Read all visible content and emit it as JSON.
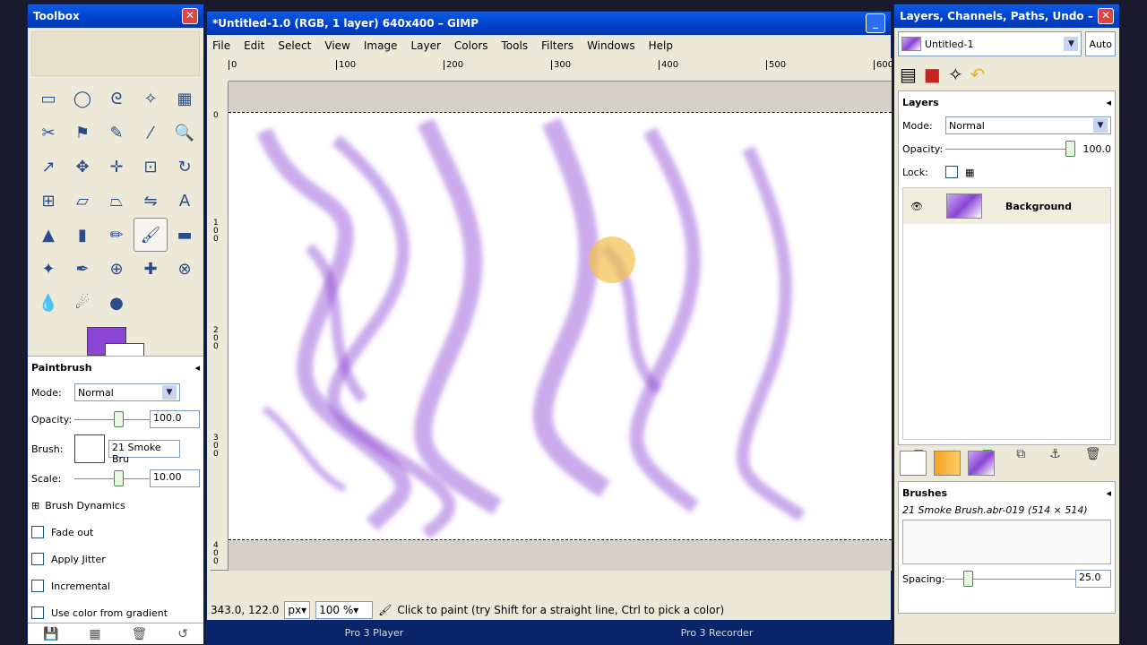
{
  "toolbox": {
    "title": "Toolbox",
    "close": "✕",
    "tool_icons": [
      "rect-select-icon",
      "ellipse-select-icon",
      "lasso-icon",
      "fuzzy-select-icon",
      "color-select-icon",
      "scissors-icon",
      "foreground-select-icon",
      "paths-icon",
      "color-picker-icon",
      "zoom-icon",
      "measure-icon",
      "move-icon",
      "align-icon",
      "crop-icon",
      "rotate-icon",
      "scale-icon",
      "shear-icon",
      "perspective-icon",
      "flip-icon",
      "text-icon",
      "bucket-fill-icon",
      "blend-icon",
      "pencil-icon",
      "paintbrush-icon",
      "eraser-icon",
      "airbrush-icon",
      "ink-icon",
      "clone-icon",
      "heal-icon",
      "perspective-clone-icon",
      "blur-icon",
      "smudge-icon",
      "dodge-icon"
    ],
    "tool_glyphs": [
      "▭",
      "◯",
      "ᘓ",
      "✧",
      "▦",
      "✂",
      "⚑",
      "✎",
      "⁄",
      "🔍",
      "↗",
      "✥",
      "✛",
      "⊡",
      "↻",
      "⊞",
      "▱",
      "⏢",
      "⇋",
      "A",
      "▲",
      "▮",
      "✏",
      "🖌",
      "▬",
      "✦",
      "✒",
      "⊕",
      "✚",
      "⊗",
      "💧",
      "☄",
      "●"
    ],
    "fg_color": "#8b45d4",
    "bg_color": "#ffffff",
    "options": {
      "title": "Paintbrush",
      "mode_label": "Mode:",
      "mode_value": "Normal",
      "opacity_label": "Opacity:",
      "opacity_value": "100.0",
      "brush_label": "Brush:",
      "brush_value": "21 Smoke Bru",
      "scale_label": "Scale:",
      "scale_value": "10.00",
      "dynamics": "Brush Dynamics",
      "fade": "Fade out",
      "jitter": "Apply Jitter",
      "incremental": "Incremental",
      "gradient": "Use color from gradient"
    }
  },
  "image_window": {
    "title": "*Untitled-1.0 (RGB, 1 layer) 640x400 – GIMP",
    "menu": [
      "File",
      "Edit",
      "Select",
      "View",
      "Image",
      "Layer",
      "Colors",
      "Tools",
      "Filters",
      "Windows",
      "Help"
    ],
    "hruler": [
      "0",
      "100",
      "200",
      "300",
      "400",
      "500",
      "600"
    ],
    "vruler": [
      "0",
      "1\n0\n0",
      "2\n0\n0",
      "3\n0\n0",
      "4\n0\n0"
    ],
    "coords": "343.0, 122.0",
    "unit": "px",
    "zoom": "100 %",
    "status": "Click to paint (try Shift for a straight line, Ctrl to pick a color)"
  },
  "taskbar": [
    "Pro 3 Player",
    "Pro 3 Recorder"
  ],
  "layers": {
    "title": "Layers, Channels, Paths, Undo – B...",
    "image_select": "Untitled-1",
    "auto": "Auto",
    "heading": "Layers",
    "mode_label": "Mode:",
    "mode_value": "Normal",
    "opacity_label": "Opacity:",
    "opacity_value": "100.0",
    "lock_label": "Lock:",
    "layer_name": "Background",
    "brushes_heading": "Brushes",
    "brush_name": "21 Smoke Brush.abr-019 (514 × 514)",
    "spacing_label": "Spacing:",
    "spacing_value": "25.0"
  }
}
